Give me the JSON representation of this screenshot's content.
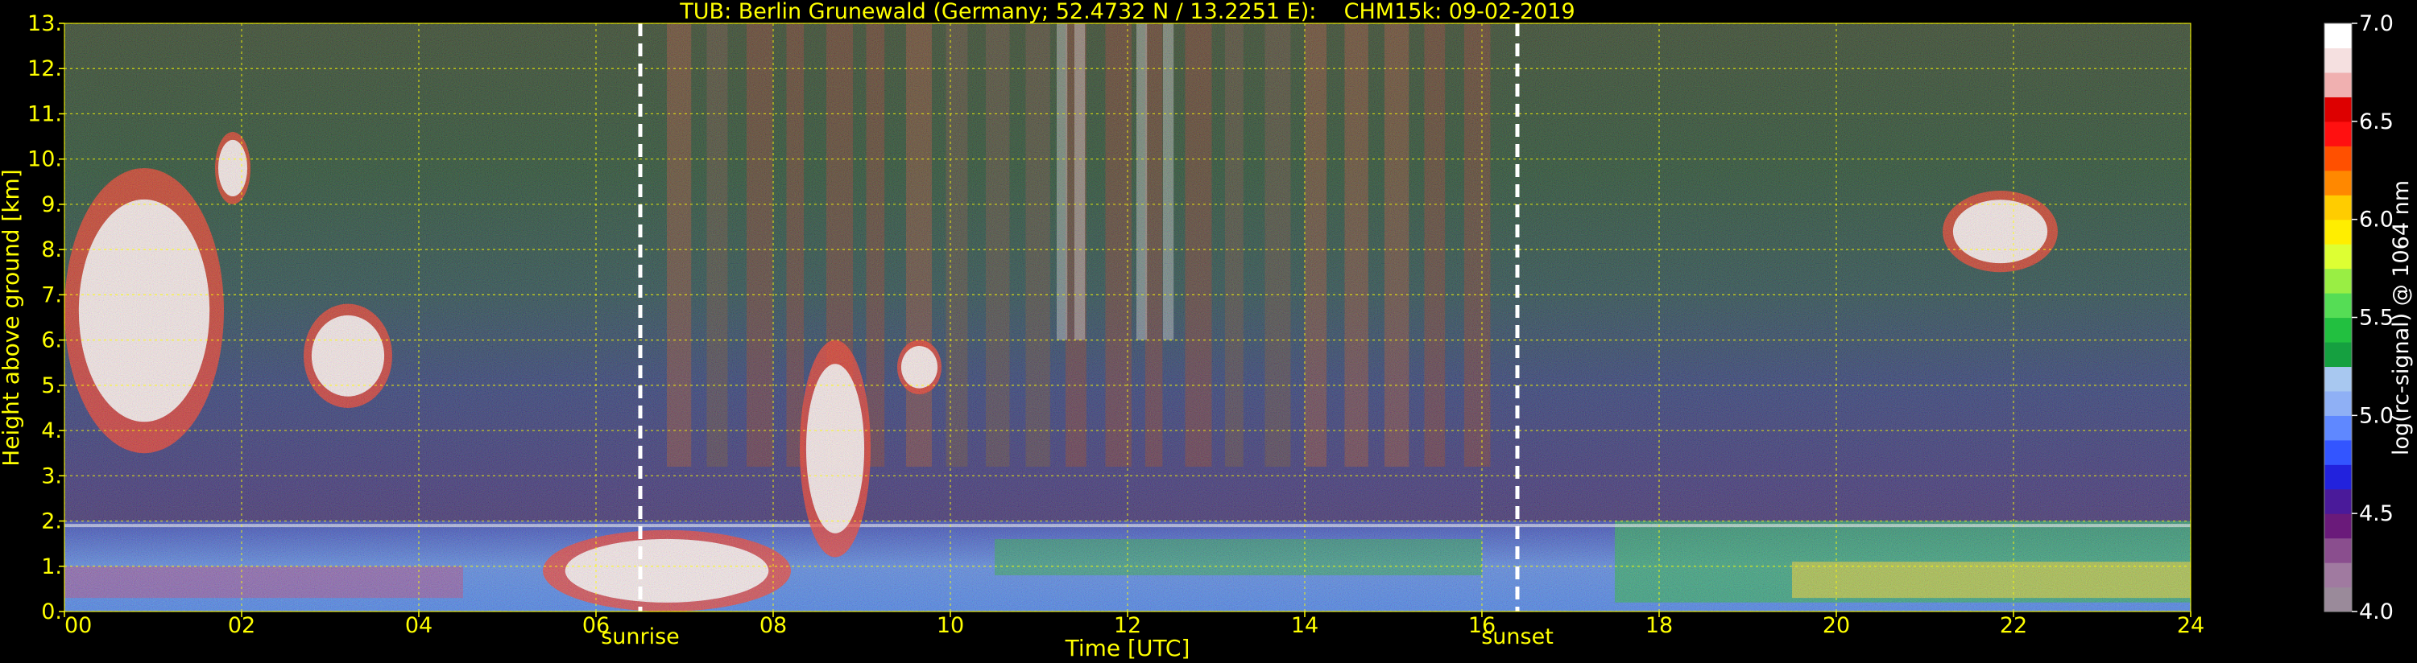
{
  "chart_data": {
    "type": "heatmap",
    "title": "TUB: Berlin Grunewald (Germany; 52.4732 N / 13.2251 E):    CHM15k: 09-02-2019",
    "xlabel": "Time [UTC]",
    "ylabel": "Height above ground [km]",
    "xlim": [
      0,
      24
    ],
    "ylim": [
      0,
      13
    ],
    "x_ticks": [
      0,
      2,
      4,
      6,
      8,
      10,
      12,
      14,
      16,
      18,
      20,
      22,
      24
    ],
    "x_tick_labels": [
      "00",
      "02",
      "04",
      "06",
      "08",
      "10",
      "12",
      "14",
      "16",
      "18",
      "20",
      "22",
      "24"
    ],
    "y_ticks": [
      0,
      1,
      2,
      3,
      4,
      5,
      6,
      7,
      8,
      9,
      10,
      11,
      12,
      13
    ],
    "y_tick_labels": [
      "0.",
      "1.",
      "2.",
      "3.",
      "4.",
      "5.",
      "6.",
      "7.",
      "8.",
      "9.",
      "10.",
      "11.",
      "12.",
      "13."
    ],
    "grid": true,
    "colorbar": {
      "label": "log(rc-signal) @ 1064 nm",
      "range": [
        4.0,
        7.0
      ],
      "tick_labels": [
        "4.0",
        "4.5",
        "5.0",
        "5.5",
        "6.0",
        "6.5",
        "7.0"
      ],
      "tick_values": [
        4.0,
        4.5,
        5.0,
        5.5,
        6.0,
        6.5,
        7.0
      ],
      "colors": [
        "#9a8a9a",
        "#a07aa0",
        "#8a4e8e",
        "#6a1a7a",
        "#4a1a9a",
        "#2222dd",
        "#3355ff",
        "#5f88ff",
        "#8fb0f5",
        "#a8c8f0",
        "#15a040",
        "#22c040",
        "#55dd55",
        "#99ee44",
        "#ddff33",
        "#ffee00",
        "#ffcc00",
        "#ff8800",
        "#ff5000",
        "#ff1010",
        "#dd0000",
        "#f0b0b0",
        "#f5e0e0",
        "#ffffff"
      ]
    },
    "events": [
      {
        "label": "sunrise",
        "time": 6.5
      },
      {
        "label": "sunset",
        "time": 16.4
      }
    ],
    "features": [
      {
        "kind": "cloud",
        "time": [
          0.0,
          1.8
        ],
        "height_km": [
          3.5,
          9.8
        ]
      },
      {
        "kind": "cloud",
        "time": [
          1.7,
          2.1
        ],
        "height_km": [
          9.0,
          10.6
        ]
      },
      {
        "kind": "cloud",
        "time": [
          2.7,
          3.7
        ],
        "height_km": [
          4.5,
          6.8
        ]
      },
      {
        "kind": "cloud",
        "time": [
          8.3,
          9.1
        ],
        "height_km": [
          1.2,
          6.0
        ]
      },
      {
        "kind": "cloud",
        "time": [
          9.4,
          9.9
        ],
        "height_km": [
          4.8,
          6.0
        ]
      },
      {
        "kind": "cloud",
        "time": [
          21.2,
          22.5
        ],
        "height_km": [
          7.5,
          9.3
        ]
      },
      {
        "kind": "low_cloud",
        "time": [
          5.4,
          8.2
        ],
        "height_km": [
          0.0,
          1.8
        ]
      },
      {
        "kind": "boundary_layer",
        "time": [
          0.0,
          24.0
        ],
        "height_km": [
          0.0,
          2.0
        ]
      }
    ]
  }
}
